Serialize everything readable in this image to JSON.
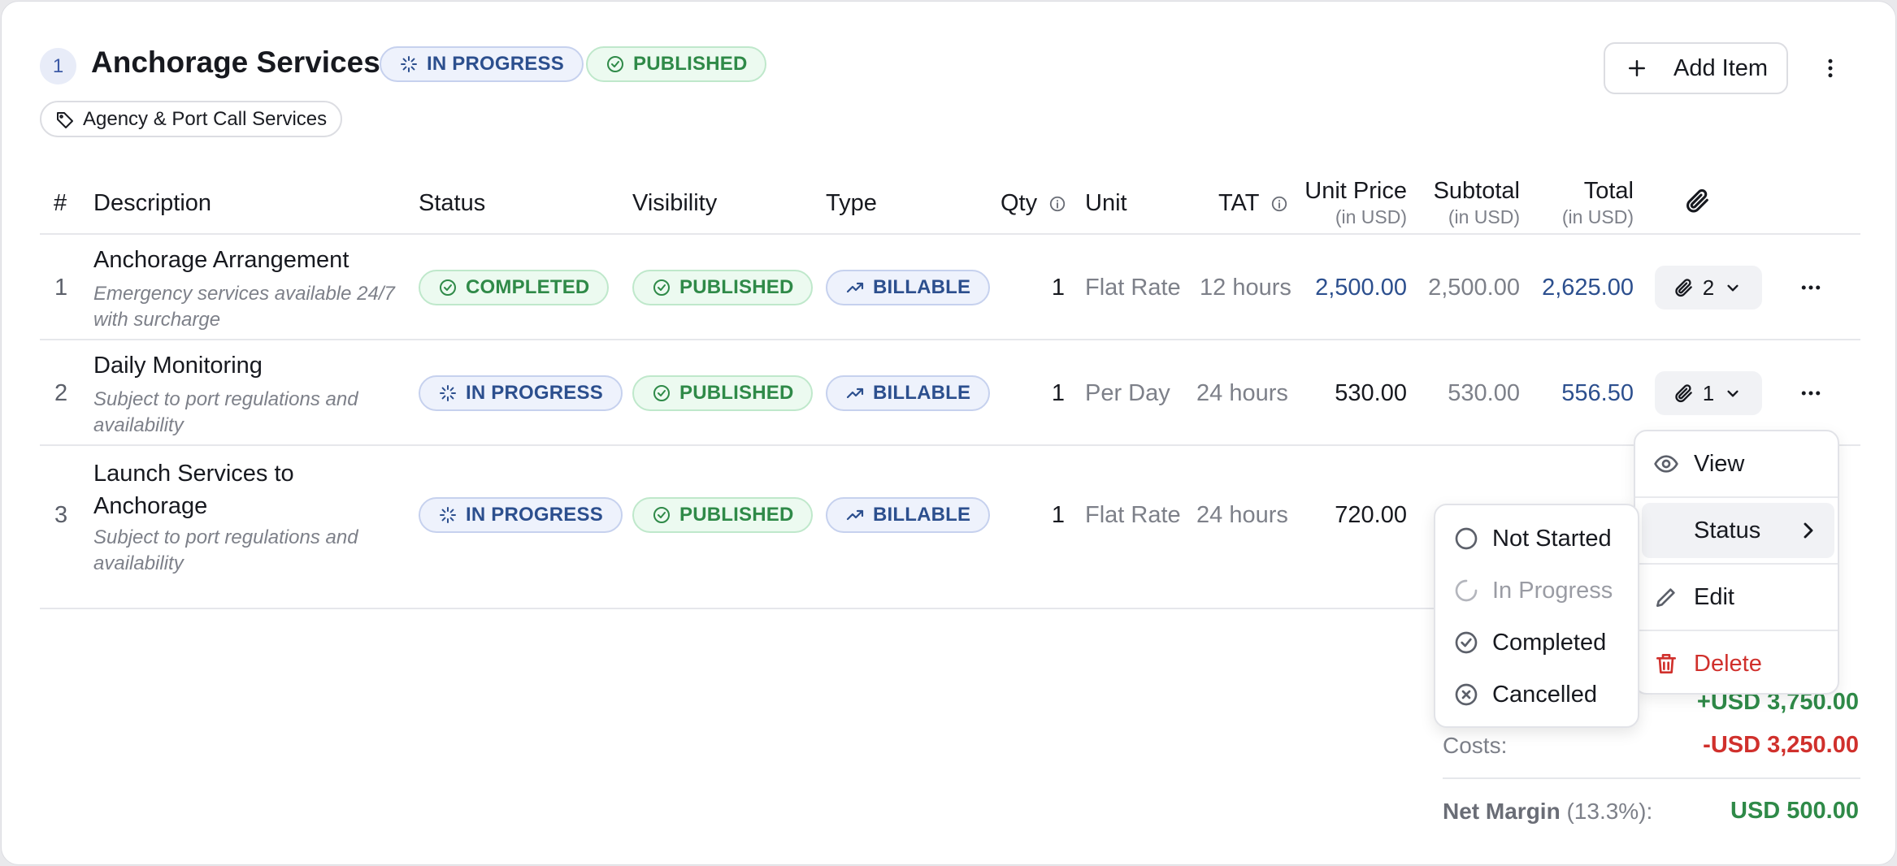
{
  "section": {
    "number": "1",
    "title": "Anchorage Services",
    "status_badge": "IN PROGRESS",
    "visibility_badge": "PUBLISHED",
    "category_tag": "Agency & Port Call Services",
    "add_item_label": "Add Item"
  },
  "table": {
    "headers": {
      "num": "#",
      "description": "Description",
      "status": "Status",
      "visibility": "Visibility",
      "type": "Type",
      "qty": "Qty",
      "unit": "Unit",
      "tat": "TAT",
      "unit_price": "Unit Price",
      "unit_price_sub": "(in USD)",
      "subtotal": "Subtotal",
      "subtotal_sub": "(in USD)",
      "total": "Total",
      "total_sub": "(in USD)"
    },
    "rows": [
      {
        "num": "1",
        "title": "Anchorage Arrangement",
        "note": "Emergency services available 24/7 with surcharge",
        "status": "COMPLETED",
        "visibility": "PUBLISHED",
        "type": "BILLABLE",
        "qty": "1",
        "unit": "Flat Rate",
        "tat": "12 hours",
        "unit_price": "2,500.00",
        "subtotal": "2,500.00",
        "total": "2,625.00",
        "attachments": "2"
      },
      {
        "num": "2",
        "title": "Daily Monitoring",
        "note": "Subject to port regulations and availability",
        "status": "IN PROGRESS",
        "visibility": "PUBLISHED",
        "type": "BILLABLE",
        "qty": "1",
        "unit": "Per Day",
        "tat": "24 hours",
        "unit_price": "530.00",
        "subtotal": "530.00",
        "total": "556.50",
        "attachments": "1"
      },
      {
        "num": "3",
        "title": "Launch Services to Anchorage",
        "note": "Subject to port regulations and availability",
        "status": "IN PROGRESS",
        "visibility": "PUBLISHED",
        "type": "BILLABLE",
        "qty": "1",
        "unit": "Flat Rate",
        "tat": "24 hours",
        "unit_price": "720.00"
      }
    ]
  },
  "summary": {
    "revenue_value": "+USD 3,750.00",
    "costs_label": "Costs:",
    "costs_value": "-USD 3,250.00",
    "net_margin_label": "Net Margin",
    "net_margin_pct": "(13.3%):",
    "net_margin_value": "USD 500.00"
  },
  "row_menu": {
    "items": [
      "View",
      "Status",
      "Edit",
      "Delete"
    ]
  },
  "status_submenu": {
    "items": [
      "Not Started",
      "In Progress",
      "Completed",
      "Cancelled"
    ]
  },
  "colors": {
    "accent_blue": "#2c4f8e",
    "success_green": "#2f8a48",
    "danger_red": "#d0302c"
  }
}
